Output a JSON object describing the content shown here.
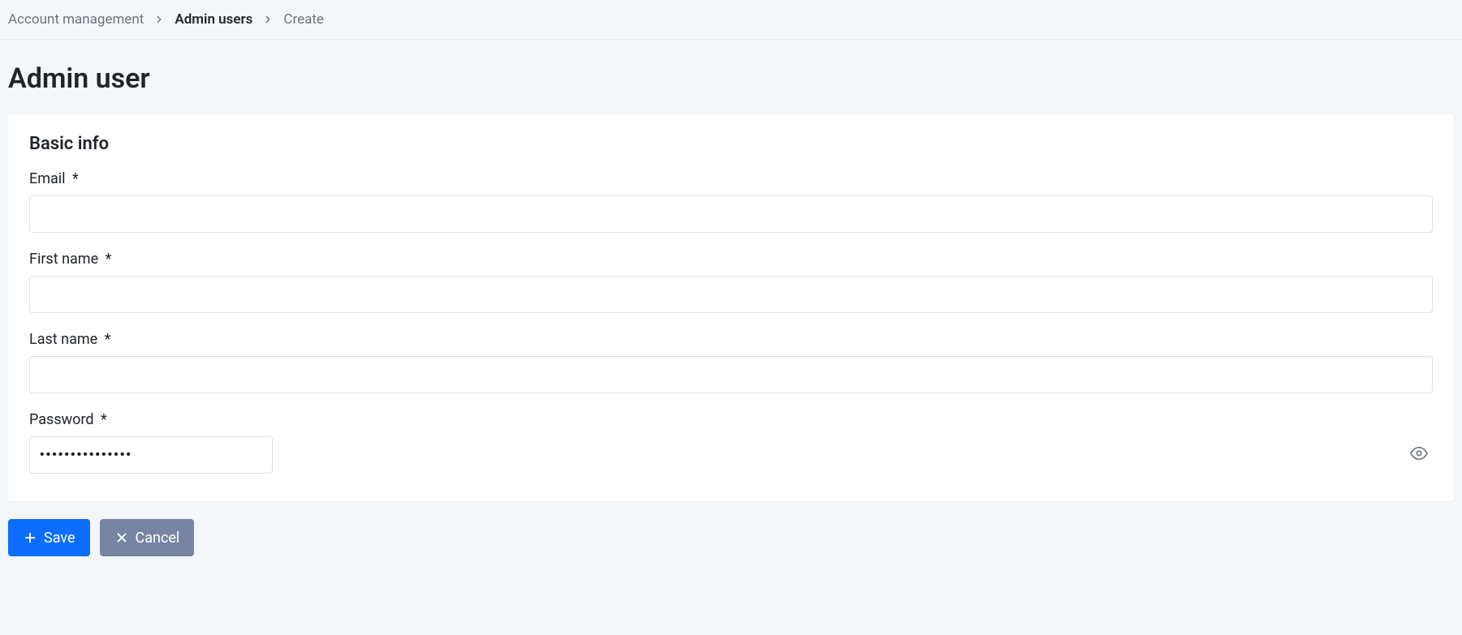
{
  "breadcrumb": {
    "items": [
      {
        "label": "Account management"
      },
      {
        "label": "Admin users"
      },
      {
        "label": "Create"
      }
    ]
  },
  "page": {
    "title": "Admin user"
  },
  "form": {
    "section_title": "Basic info",
    "fields": {
      "email": {
        "label": "Email",
        "required": "*",
        "value": ""
      },
      "first_name": {
        "label": "First name",
        "required": "*",
        "value": ""
      },
      "last_name": {
        "label": "Last name",
        "required": "*",
        "value": ""
      },
      "password": {
        "label": "Password",
        "required": "*",
        "value": "•••••••••••••••"
      }
    }
  },
  "actions": {
    "save_label": "Save",
    "cancel_label": "Cancel"
  }
}
